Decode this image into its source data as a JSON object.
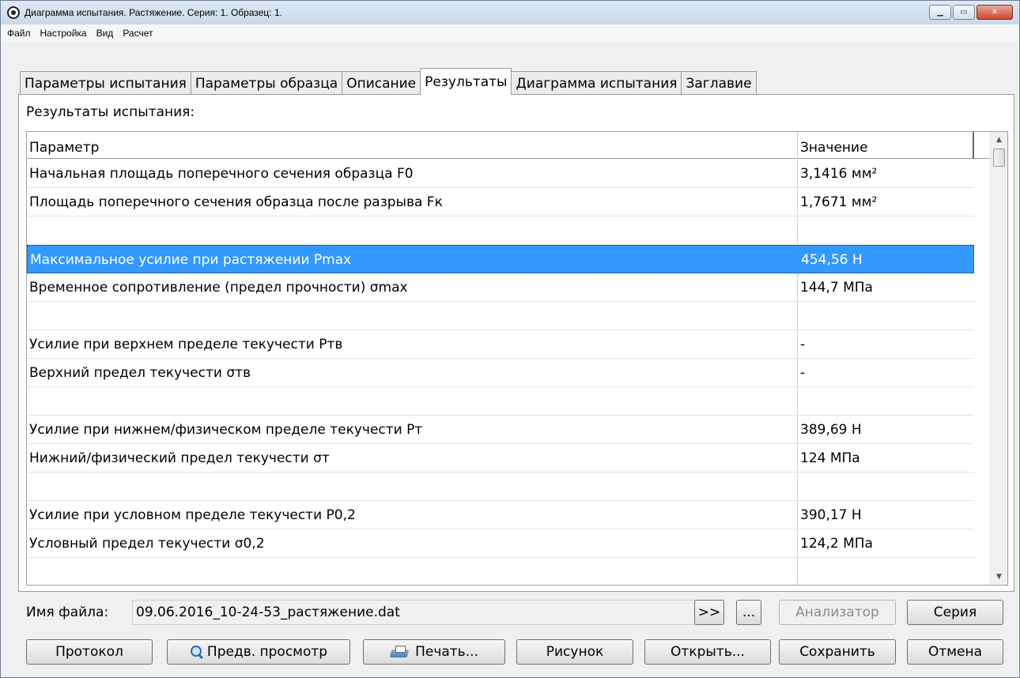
{
  "window": {
    "title": "Диаграмма испытания. Растяжение. Серия: 1. Образец: 1.",
    "buttons": {
      "minimize": "▁",
      "maximize": "▭",
      "close": "✕"
    }
  },
  "menu": [
    "Файл",
    "Настройка",
    "Вид",
    "Расчет"
  ],
  "tabs": [
    "Параметры испытания",
    "Параметры образца",
    "Описание",
    "Результаты",
    "Диаграмма испытания",
    "Заглавие"
  ],
  "active_tab": "Результаты",
  "results": {
    "label": "Результаты испытания:",
    "columns": {
      "param": "Параметр",
      "value": "Значение"
    },
    "rows": [
      {
        "param": "Начальная площадь поперечного сечения образца F0",
        "value": "3,1416 мм²"
      },
      {
        "param": "Площадь поперечного сечения образца после разрыва Fк",
        "value": "1,7671 мм²"
      },
      {
        "param": "",
        "value": ""
      },
      {
        "param": "Максимальное усилие при растяжении Pmax",
        "value": "454,56 Н",
        "selected": true
      },
      {
        "param": "Временное сопротивление (предел прочности) σmax",
        "value": "144,7 МПа"
      },
      {
        "param": "",
        "value": ""
      },
      {
        "param": "Усилие при верхнем пределе текучести Pтв",
        "value": "-"
      },
      {
        "param": "Верхний предел текучести σтв",
        "value": "-"
      },
      {
        "param": "",
        "value": ""
      },
      {
        "param": "Усилие при нижнем/физическом пределе текучести Pт",
        "value": "389,69 Н"
      },
      {
        "param": "Нижний/физический предел текучести σт",
        "value": "124 МПа"
      },
      {
        "param": "",
        "value": ""
      },
      {
        "param": "Усилие при условном пределе текучести P0,2",
        "value": "390,17 Н"
      },
      {
        "param": "Условный предел текучести σ0,2",
        "value": "124,2 МПа"
      },
      {
        "param": "",
        "value": ""
      }
    ]
  },
  "file": {
    "label": "Имя файла:",
    "value": "09.06.2016_10-24-53_растяжение.dat"
  },
  "buttons": {
    "next": ">>",
    "browse": "...",
    "analyzer": "Анализатор",
    "series": "Серия",
    "protocol": "Протокол",
    "preview": "Предв. просмотр",
    "print": "Печать...",
    "picture": "Рисунок",
    "open": "Открыть...",
    "save": "Сохранить",
    "cancel": "Отмена"
  },
  "scrollbar": {
    "up": "▲",
    "down": "▼"
  }
}
